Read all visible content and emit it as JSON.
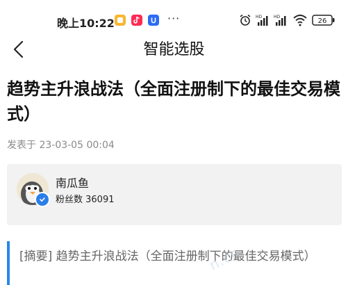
{
  "status_bar": {
    "time": "晚上10:22",
    "more": "···",
    "battery": "26",
    "icons": [
      "yellow-app-icon",
      "tiktok-icon",
      "blue-app-icon",
      "alarm-icon",
      "hd-signal-icon",
      "hd-signal-icon",
      "wifi-icon",
      "battery-icon"
    ],
    "hd_label": "HD"
  },
  "nav": {
    "title": "智能选股",
    "back_icon": "chevron-left-icon"
  },
  "article": {
    "title": "趋势主升浪战法（全面注册制下的最佳交易模式）",
    "publish_info": "发表于 23-03-05 00:04"
  },
  "author": {
    "name": "南瓜鱼",
    "followers": "粉丝数 36091",
    "verified_icon": "verified-check-icon"
  },
  "summary": {
    "text": "[摘要] 趋势主升浪战法（全面注册制下的最佳交易模式）"
  },
  "watermark": {
    "text": "n.cn"
  },
  "colors": {
    "accent": "#2a86e8",
    "card_bg": "#f2f2f2",
    "muted_text": "#8a8a8a"
  }
}
